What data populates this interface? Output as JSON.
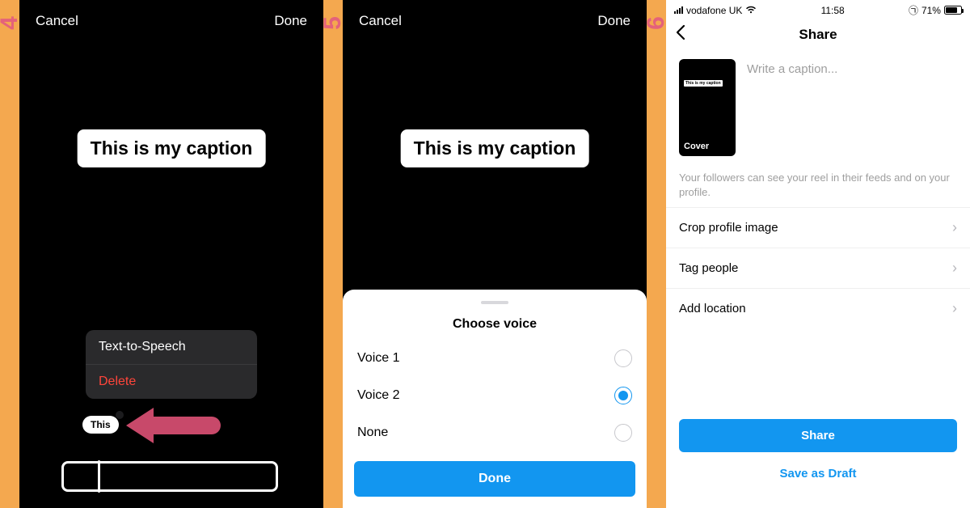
{
  "steps": {
    "s4": "4",
    "s5": "5",
    "s6": "6"
  },
  "panel1": {
    "cancel": "Cancel",
    "done": "Done",
    "caption": "This is my caption",
    "menu": {
      "tts": "Text-to-Speech",
      "delete": "Delete"
    },
    "chip": "This"
  },
  "panel2": {
    "cancel": "Cancel",
    "done": "Done",
    "caption": "This is my caption",
    "sheet": {
      "title": "Choose voice",
      "voice1": "Voice 1",
      "voice2": "Voice 2",
      "none": "None",
      "done": "Done"
    }
  },
  "panel3": {
    "status": {
      "carrier": "vodafone UK",
      "time": "11:58",
      "battery": "71%"
    },
    "title": "Share",
    "thumb_caption": "This is my caption",
    "cover": "Cover",
    "placeholder": "Write a caption...",
    "hint": "Your followers can see your reel in their feeds and on your profile.",
    "rows": {
      "crop": "Crop profile image",
      "tag": "Tag people",
      "location": "Add location"
    },
    "share": "Share",
    "draft": "Save as Draft"
  }
}
